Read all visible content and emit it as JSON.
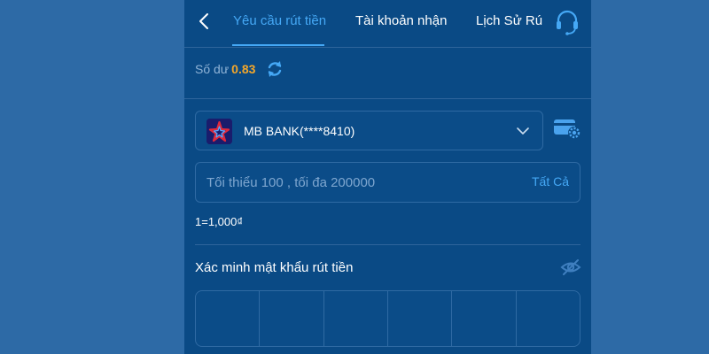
{
  "nav": {
    "back_icon": "chevron-left-icon",
    "tabs": [
      {
        "label": "Yêu cầu rút tiền",
        "active": true
      },
      {
        "label": "Tài khoản nhận",
        "active": false
      },
      {
        "label": "Lịch Sử Rú",
        "active": false
      }
    ],
    "support_icon": "headset-icon"
  },
  "balance": {
    "label": "Số dư",
    "value": "0.83",
    "refresh_icon": "refresh-icon"
  },
  "bank": {
    "name": "MB BANK(****8410)",
    "logo_icon": "mb-bank-star-logo",
    "chevron_icon": "chevron-down-icon",
    "settings_icon": "card-settings-icon"
  },
  "amount": {
    "value": "",
    "placeholder": "Tối thiểu 100 , tối đa 200000",
    "all_label": "Tất Cả"
  },
  "rate": "1=1,000₫",
  "password": {
    "label": "Xác minh mật khẩu rút tiền",
    "eye_icon": "eye-off-icon",
    "digits": [
      "",
      "",
      "",
      "",
      "",
      ""
    ]
  },
  "colors": {
    "page_bg": "#2d6aa6",
    "panel_bg": "#0a4a85",
    "accent": "#45a8f5",
    "balance": "#f4a72a",
    "border": "#2f6aa3"
  }
}
